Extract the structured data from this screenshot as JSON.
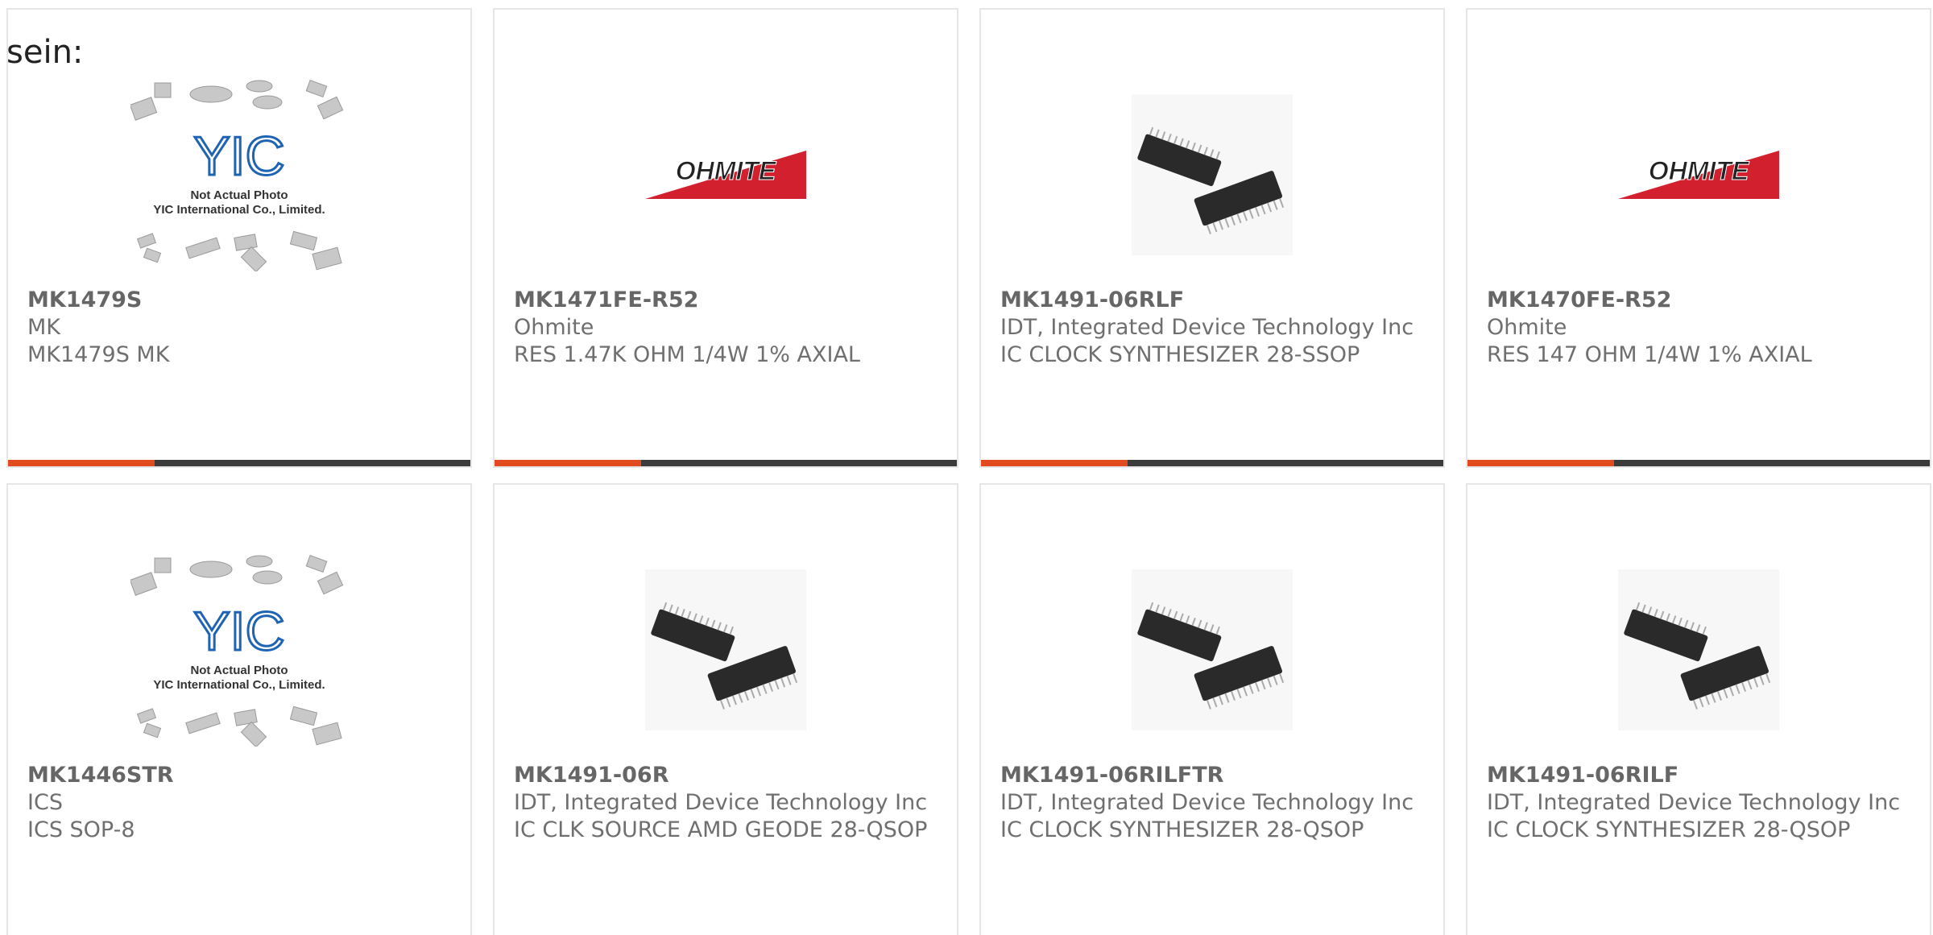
{
  "intro_text": "sein:",
  "placeholder_image": {
    "line1": "Not Actual Photo",
    "line2": "YIC International Co., Limited.",
    "logo": "YIC"
  },
  "brand_logo_text": "OHMITE",
  "colors": {
    "accent": "#e24a1f",
    "bar": "#3b3b3b",
    "yic_blue": "#1f64b4",
    "ohmite_red": "#d3202e"
  },
  "products": [
    {
      "part": "MK1479S",
      "manufacturer": "MK",
      "description": "MK1479S MK",
      "image": "placeholder"
    },
    {
      "part": "MK1471FE-R52",
      "manufacturer": "Ohmite",
      "description": "RES 1.47K OHM 1/4W 1% AXIAL",
      "image": "ohmite-logo"
    },
    {
      "part": "MK1491-06RLF",
      "manufacturer": "IDT, Integrated Device Technology Inc",
      "description": "IC CLOCK SYNTHESIZER 28-SSOP",
      "image": "chip"
    },
    {
      "part": "MK1470FE-R52",
      "manufacturer": "Ohmite",
      "description": "RES 147 OHM 1/4W 1% AXIAL",
      "image": "ohmite-logo"
    },
    {
      "part": "MK1446STR",
      "manufacturer": "ICS",
      "description": "ICS SOP-8",
      "image": "placeholder"
    },
    {
      "part": "MK1491-06R",
      "manufacturer": "IDT, Integrated Device Technology Inc",
      "description": "IC CLK SOURCE AMD GEODE 28-QSOP",
      "image": "chip"
    },
    {
      "part": "MK1491-06RILFTR",
      "manufacturer": "IDT, Integrated Device Technology Inc",
      "description": "IC CLOCK SYNTHESIZER 28-QSOP",
      "image": "chip"
    },
    {
      "part": "MK1491-06RILF",
      "manufacturer": "IDT, Integrated Device Technology Inc",
      "description": "IC CLOCK SYNTHESIZER 28-QSOP",
      "image": "chip"
    }
  ]
}
